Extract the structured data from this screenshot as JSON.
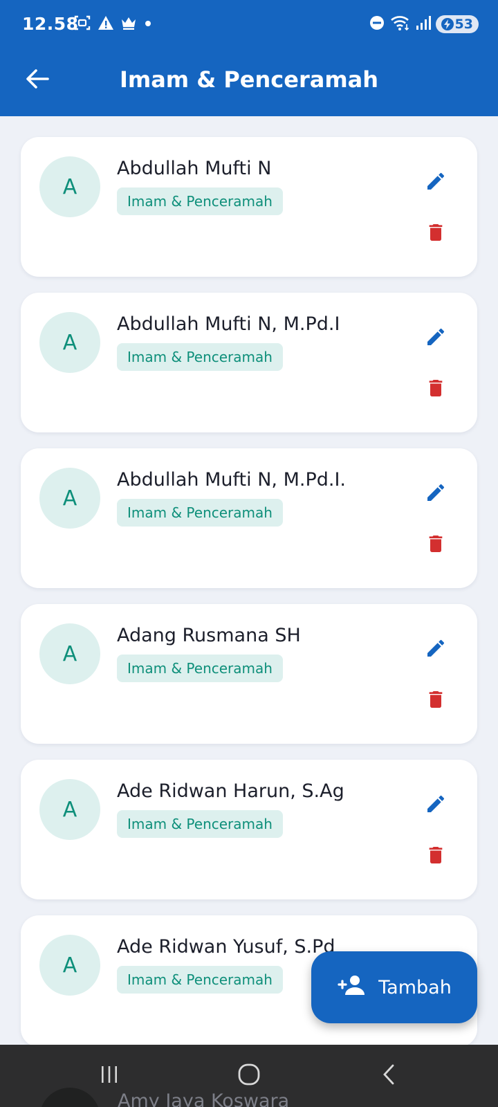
{
  "status_bar": {
    "time": "12.58",
    "battery": "53"
  },
  "header": {
    "title": "Imam & Penceramah"
  },
  "people": [
    {
      "initial": "A",
      "name": "Abdullah Mufti N",
      "role": "Imam & Penceramah"
    },
    {
      "initial": "A",
      "name": "Abdullah Mufti N, M.Pd.I",
      "role": "Imam & Penceramah"
    },
    {
      "initial": "A",
      "name": "Abdullah Mufti N, M.Pd.I.",
      "role": "Imam & Penceramah"
    },
    {
      "initial": "A",
      "name": "Adang Rusmana SH",
      "role": "Imam & Penceramah"
    },
    {
      "initial": "A",
      "name": "Ade Ridwan Harun, S.Ag",
      "role": "Imam & Penceramah"
    },
    {
      "initial": "A",
      "name": "Ade Ridwan Yusuf, S.Pd",
      "role": "Imam & Penceramah"
    }
  ],
  "peek_person": {
    "name": "Amy Jaya Koswara"
  },
  "fab": {
    "label": "Tambah",
    "icon": "person-add-icon"
  },
  "icons": {
    "edit": "pencil-icon",
    "delete": "trash-icon",
    "back": "arrow-left-icon"
  },
  "colors": {
    "primary": "#1565c0",
    "accent_teal": "#0e8f7a",
    "badge_bg": "#ddf0ee",
    "delete_red": "#d32f2f",
    "background": "#eef1f7"
  }
}
